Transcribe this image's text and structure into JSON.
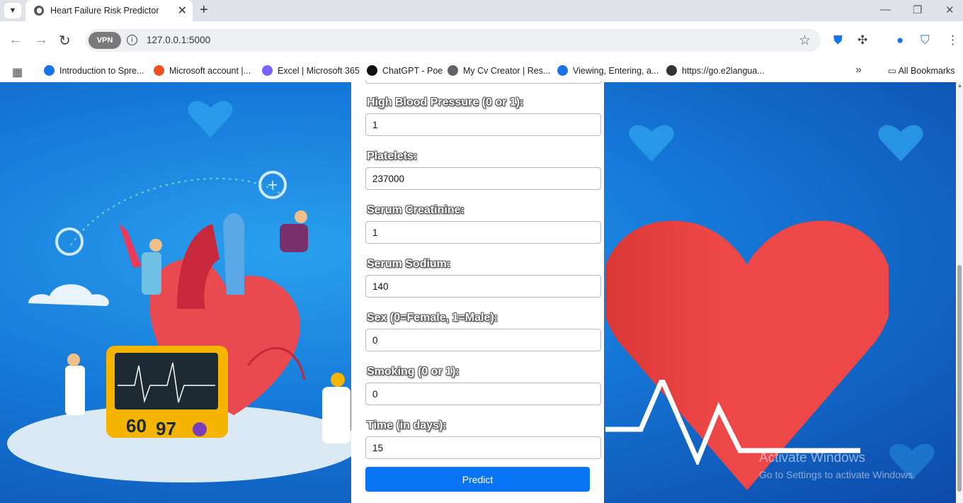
{
  "browser": {
    "tab": {
      "title": "Heart Failure Risk Predictor"
    },
    "url": "127.0.0.1:5000",
    "vpn_label": "VPN",
    "bookmarks": [
      {
        "label": "Introduction to Spre...",
        "color": "#1a73e8"
      },
      {
        "label": "Microsoft account |...",
        "color": "#f25022"
      },
      {
        "label": "Excel | Microsoft 365",
        "color": "#7b61ff"
      },
      {
        "label": "ChatGPT - Poe",
        "color": "#111111"
      },
      {
        "label": "My Cv Creator | Res...",
        "color": "#5f6368"
      },
      {
        "label": "Viewing, Entering, a...",
        "color": "#1a73e8"
      },
      {
        "label": "https://go.e2langua...",
        "color": "#333333"
      }
    ],
    "all_bookmarks": "All Bookmarks"
  },
  "form": {
    "fields": [
      {
        "label": "High Blood Pressure (0 or 1):",
        "value": "1"
      },
      {
        "label": "Platelets:",
        "value": "237000"
      },
      {
        "label": "Serum Creatinine:",
        "value": "1"
      },
      {
        "label": "Serum Sodium:",
        "value": "140"
      },
      {
        "label": "Sex (0=Female, 1=Male):",
        "value": "0"
      },
      {
        "label": "Smoking (0 or 1):",
        "value": "0"
      },
      {
        "label": "Time (in days):",
        "value": "15"
      }
    ],
    "submit_label": "Predict",
    "accent": "#0a74f6"
  },
  "background": {
    "monitor_numbers": [
      "60",
      "97"
    ]
  },
  "watermark": {
    "line1": "Activate Windows",
    "line2": "Go to Settings to activate Windows."
  }
}
